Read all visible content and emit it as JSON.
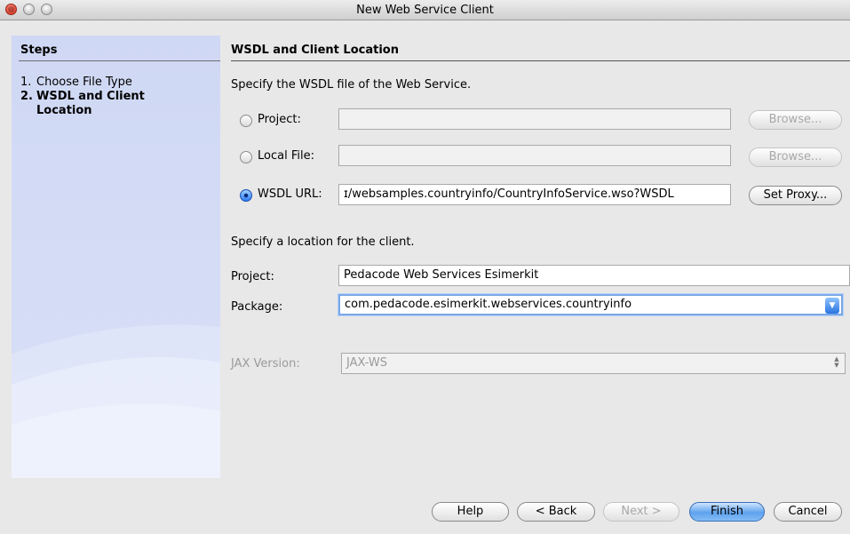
{
  "window": {
    "title": "New Web Service Client"
  },
  "steps": {
    "header": "Steps",
    "items": [
      {
        "num": "1.",
        "label": "Choose File Type",
        "active": false
      },
      {
        "num": "2.",
        "label": "WSDL and Client Location",
        "active": true
      }
    ]
  },
  "main": {
    "section_title": "WSDL and Client Location",
    "wsdl_prompt": "Specify the WSDL file of the Web Service.",
    "source_options": [
      {
        "label": "Project:",
        "value": "",
        "button": "Browse...",
        "selected": false,
        "button_enabled": false
      },
      {
        "label": "Local File:",
        "value": "",
        "button": "Browse...",
        "selected": false,
        "button_enabled": false
      },
      {
        "label": "WSDL URL:",
        "value": "ɪ/websamples.countryinfo/CountryInfoService.wso?WSDL",
        "button": "Set Proxy...",
        "selected": true,
        "button_enabled": true
      }
    ],
    "location_prompt": "Specify a location for the client.",
    "project": {
      "label": "Project:",
      "value": "Pedacode Web Services Esimerkit"
    },
    "package": {
      "label": "Package:",
      "value": "com.pedacode.esimerkit.webservices.countryinfo"
    },
    "jax": {
      "label": "JAX Version:",
      "value": "JAX-WS"
    }
  },
  "buttons": {
    "help": "Help",
    "back": "< Back",
    "next": "Next >",
    "finish": "Finish",
    "cancel": "Cancel"
  },
  "colors": {
    "accent": "#3b7ae0",
    "steps_panel": "#d3dbf5"
  }
}
